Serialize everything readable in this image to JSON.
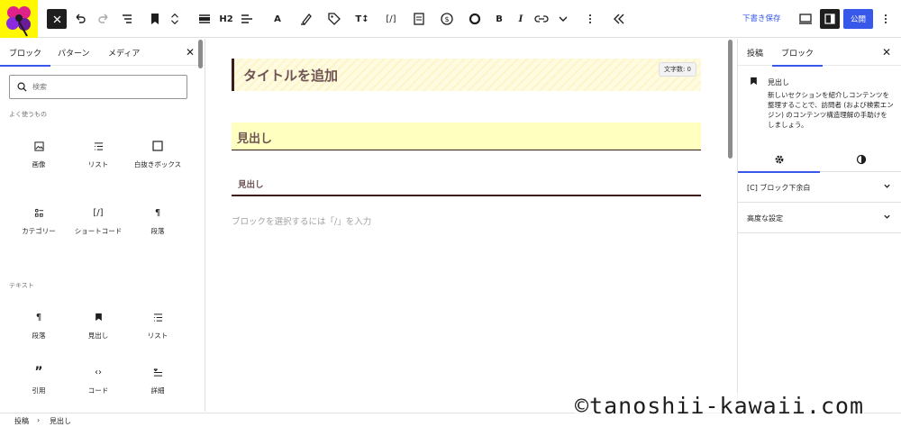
{
  "toolbar": {
    "h2_label": "H2",
    "a_label": "A",
    "tt_label": "T↕",
    "shortcode_label": "[/]",
    "bold_label": "B",
    "italic_label": "I",
    "draft_label": "下書き保存",
    "publish_label": "公開",
    "accent_color": "#3858e9"
  },
  "inserter": {
    "tabs": [
      "ブロック",
      "パターン",
      "メディア"
    ],
    "search_placeholder": "検索",
    "frequent_title": "よく使うもの",
    "frequent": [
      {
        "icon": "image-icon",
        "label": "画像"
      },
      {
        "icon": "list-icon",
        "label": "リスト"
      },
      {
        "icon": "box-icon",
        "label": "白抜きボックス"
      },
      {
        "icon": "category-icon",
        "label": "カテゴリー"
      },
      {
        "icon": "shortcode-icon",
        "glyph": "[/]",
        "label": "ショートコード"
      },
      {
        "icon": "paragraph-icon",
        "glyph": "¶",
        "label": "段落"
      }
    ],
    "text_title": "テキスト",
    "text_blocks": [
      {
        "icon": "paragraph-icon",
        "glyph": "¶",
        "label": "段落"
      },
      {
        "icon": "heading-bookmark-icon",
        "label": "見出し"
      },
      {
        "icon": "list-icon",
        "label": "リスト"
      },
      {
        "icon": "quote-icon",
        "glyph": "”",
        "label": "引用"
      },
      {
        "icon": "code-icon",
        "glyph": "‹›",
        "label": "コード"
      },
      {
        "icon": "details-icon",
        "label": "詳細"
      }
    ]
  },
  "canvas": {
    "title_placeholder": "タイトルを追加",
    "word_count": "文字数: 0",
    "heading_h2": "見出し",
    "heading_h3": "見出し",
    "paragraph_placeholder": "ブロックを選択するには「/」を入力"
  },
  "sidebar": {
    "tabs": [
      "投稿",
      "ブロック"
    ],
    "block_title": "見出し",
    "block_description": "新しいセクションを紹介しコンテンツを整理することで、訪問者 (および検索エンジン) のコンテンツ構造理解の手助けをしましょう。",
    "panels": [
      "[C] ブロック下余白",
      "高度な設定"
    ]
  },
  "footer": {
    "crumbs": [
      "投稿",
      "見出し"
    ],
    "separator": "›"
  },
  "watermark": "©tanoshii-kawaii.com"
}
